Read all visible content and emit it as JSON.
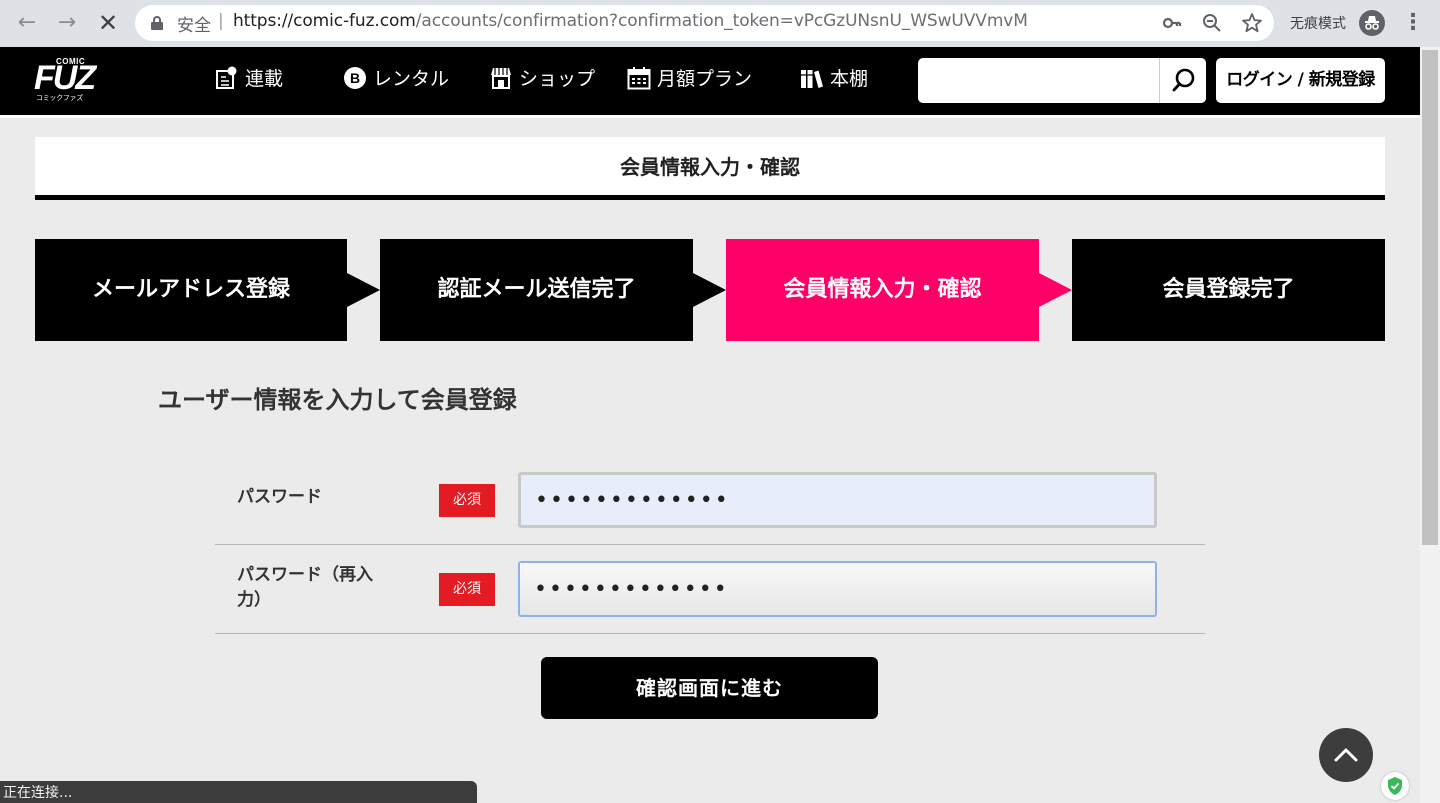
{
  "browser": {
    "secure_label": "安全",
    "url_host": "https://comic-fuz.com",
    "url_path": "/accounts/confirmation?confirmation_token=vPcGzUNsnU_WSwUVVmvM",
    "incognito_label": "无痕模式",
    "status_text": "正在连接..."
  },
  "header": {
    "logo_text": "FUZ",
    "logo_sub": "COMIC",
    "logo_kana": "コミックファズ",
    "nav": [
      {
        "label": "連載",
        "icon": "serial-icon"
      },
      {
        "label": "レンタル",
        "icon": "rental-icon"
      },
      {
        "label": "ショップ",
        "icon": "shop-icon"
      },
      {
        "label": "月額プラン",
        "icon": "calendar-icon"
      },
      {
        "label": "本棚",
        "icon": "bookshelf-icon"
      }
    ],
    "search_placeholder": "",
    "login_label": "ログイン / 新規登録"
  },
  "page": {
    "title": "会員情報入力・確認"
  },
  "steps": [
    {
      "label": "メールアドレス登録",
      "active": false
    },
    {
      "label": "認証メール送信完了",
      "active": false
    },
    {
      "label": "会員情報入力・確認",
      "active": true
    },
    {
      "label": "会員登録完了",
      "active": false
    }
  ],
  "form": {
    "heading": "ユーザー情報を入力して会員登録",
    "fields": [
      {
        "label": "パスワード",
        "required_label": "必須",
        "value": "•••••••••••••"
      },
      {
        "label": "パスワード（再入力）",
        "required_label": "必須",
        "value": "•••••••••••••"
      }
    ],
    "submit_label": "確認画面に進む"
  },
  "colors": {
    "accent": "#ff0068",
    "required": "#e31b23",
    "header_bg": "#000000",
    "page_bg": "#ebebeb"
  }
}
